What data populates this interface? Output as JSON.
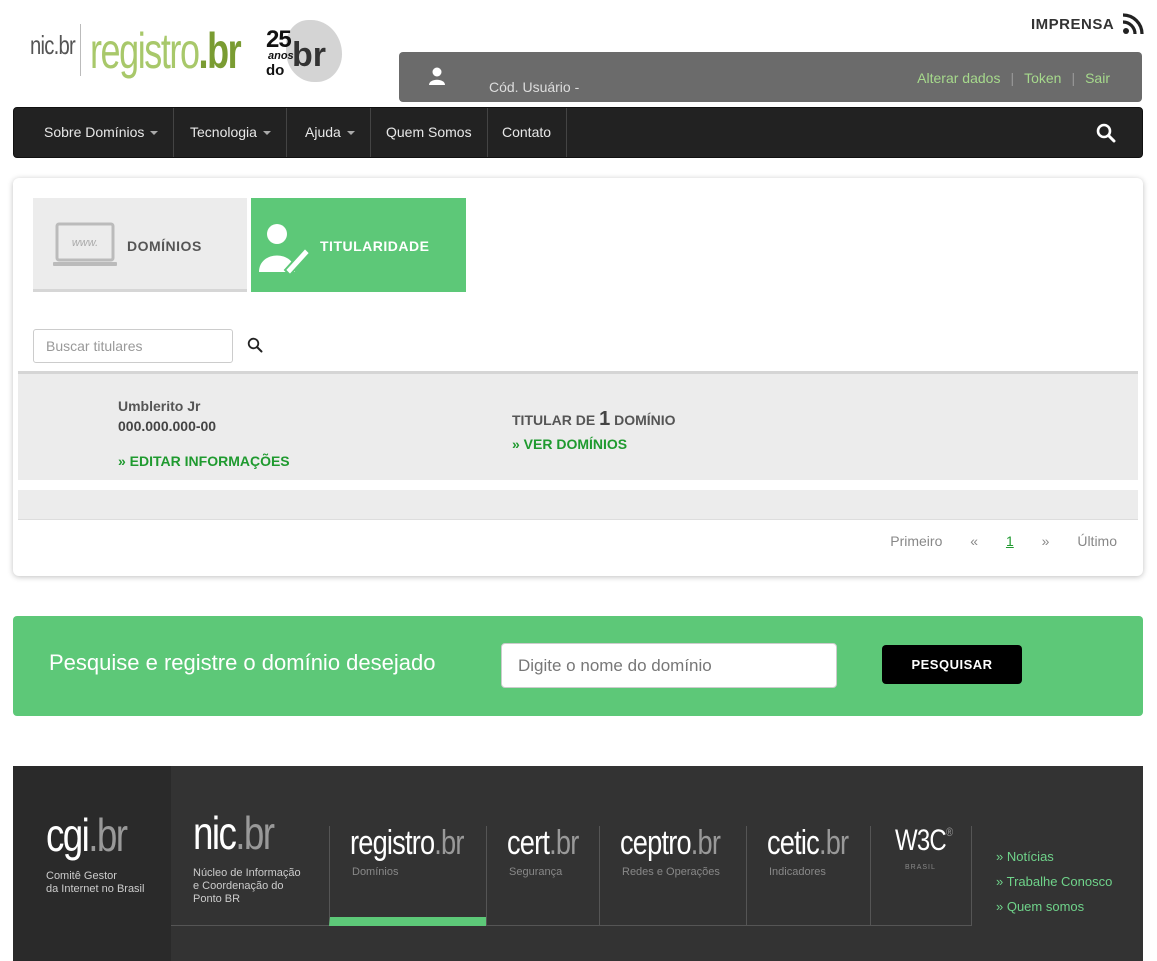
{
  "header": {
    "logo_nic": "nic.br",
    "logo_registro": "registro",
    "logo_registro_suffix": ".br",
    "logo_25": "25",
    "logo_anos": "anos",
    "logo_do": "do",
    "logo_br": "br",
    "imprensa": "IMPRENSA"
  },
  "userbar": {
    "code_label": "Cód. Usuário -",
    "alterar": "Alterar dados",
    "token": "Token",
    "sair": "Sair",
    "pipe": "|"
  },
  "nav": {
    "items": [
      {
        "label": "Sobre Domínios"
      },
      {
        "label": "Tecnologia"
      },
      {
        "label": "Ajuda"
      },
      {
        "label": "Quem Somos"
      },
      {
        "label": "Contato"
      }
    ]
  },
  "tabs": {
    "dominios": "DOMÍNIOS",
    "titularidade": "TITULARIDADE",
    "laptop_text": "www."
  },
  "holder_search": {
    "placeholder": "Buscar titulares"
  },
  "holder": {
    "name": "Umblerito Jr",
    "document": "000.000.000-00",
    "edit": "» EDITAR INFORMAÇÕES",
    "count_prefix": "TITULAR DE",
    "count": "1",
    "count_suffix": "DOMÍNIO",
    "view": "» VER DOMÍNIOS"
  },
  "pager": {
    "first": "Primeiro",
    "prev": "«",
    "current": "1",
    "next": "»",
    "last": "Último"
  },
  "band": {
    "title": "Pesquise e registre o domínio desejado",
    "placeholder": "Digite o nome do domínio",
    "button": "PESQUISAR"
  },
  "footer": {
    "cgi_logo": "cgi",
    "cgi_br": ".br",
    "cgi_desc1": "Comitê Gestor",
    "cgi_desc2": "da Internet no Brasil",
    "nic_logo": "nic",
    "nic_br": ".br",
    "nic_desc1": "Núcleo de Informação",
    "nic_desc2": "e Coordenação do",
    "nic_desc3": "Ponto BR",
    "sites": [
      {
        "name": "registro",
        "suffix": ".br",
        "sub": "Domínios"
      },
      {
        "name": "cert",
        "suffix": ".br",
        "sub": "Segurança"
      },
      {
        "name": "ceptro",
        "suffix": ".br",
        "sub": "Redes e Operações"
      },
      {
        "name": "cetic",
        "suffix": ".br",
        "sub": "Indicadores"
      },
      {
        "name": "W3C",
        "suffix": "®",
        "sub": "BRASIL"
      }
    ],
    "links": [
      "» Notícias",
      "» Trabalhe Conosco",
      "» Quem somos"
    ]
  },
  "colors": {
    "brand_green": "#5dc878",
    "link_green": "#1f9a2f",
    "nav_bg": "#222222",
    "userbar_bg": "#6b6b6b",
    "footer_bg": "#333333"
  }
}
